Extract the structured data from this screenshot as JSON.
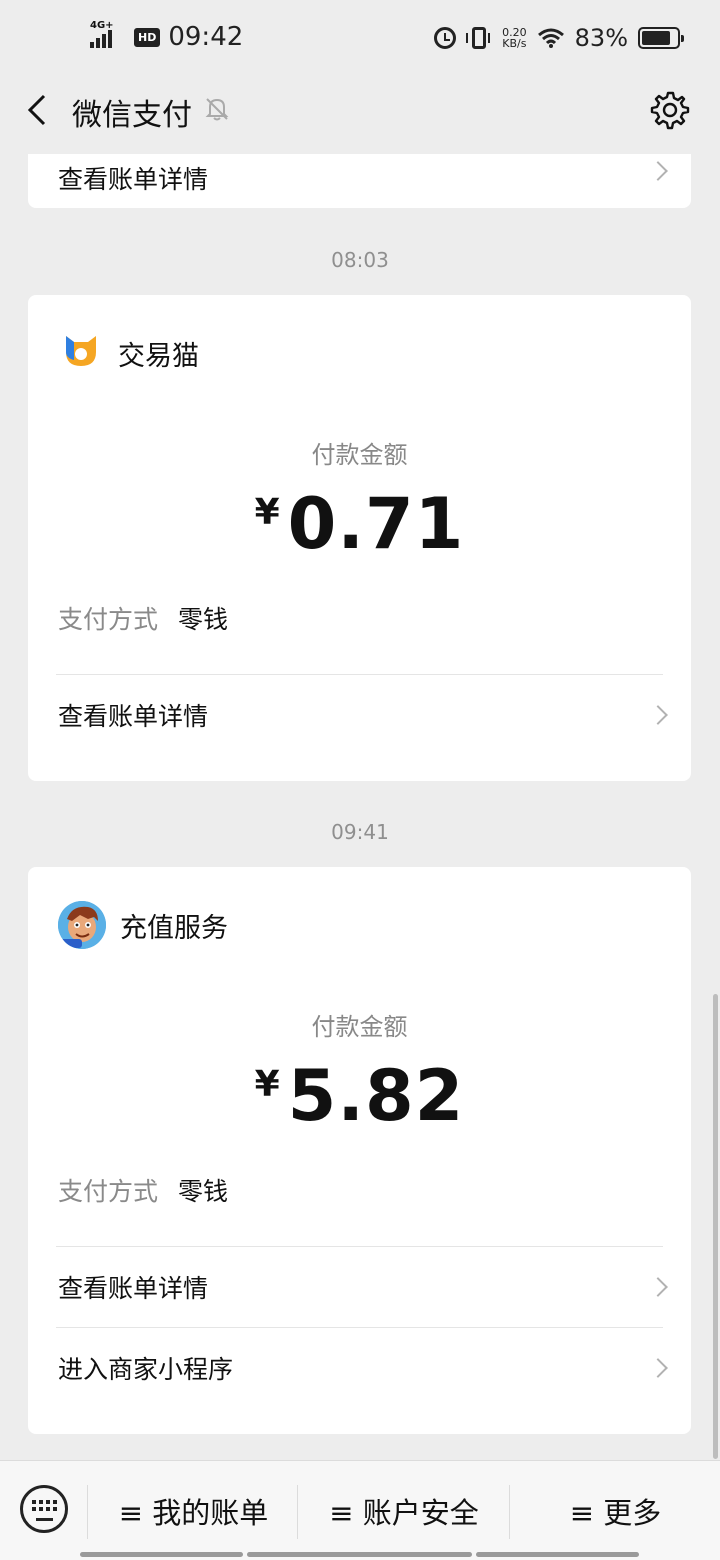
{
  "status_bar": {
    "network": "4G+",
    "hd": "HD",
    "time": "09:42",
    "speed_value": "0.20",
    "speed_unit": "KB/s",
    "battery": "83%"
  },
  "nav": {
    "title": "微信支付"
  },
  "top_partial_card": {
    "link": "查看账单详情"
  },
  "transactions": [
    {
      "time": "08:03",
      "merchant": "交易猫",
      "amount_label": "付款金额",
      "currency": "¥",
      "amount": "0.71",
      "pay_method_label": "支付方式",
      "pay_method_value": "零钱",
      "links": [
        "查看账单详情"
      ]
    },
    {
      "time": "09:41",
      "merchant": "充值服务",
      "amount_label": "付款金额",
      "currency": "¥",
      "amount": "5.82",
      "pay_method_label": "支付方式",
      "pay_method_value": "零钱",
      "links": [
        "查看账单详情",
        "进入商家小程序"
      ]
    }
  ],
  "bottom_menu": {
    "items": [
      "≡ 我的账单",
      "≡ 账户安全",
      "≡ 更多"
    ]
  },
  "colors": {
    "background": "#ededed",
    "card": "#ffffff",
    "muted_text": "#888888"
  },
  "icons": [
    "back-arrow-icon",
    "mute-bell-icon",
    "gear-icon",
    "keyboard-icon",
    "chevron-right-icon"
  ]
}
